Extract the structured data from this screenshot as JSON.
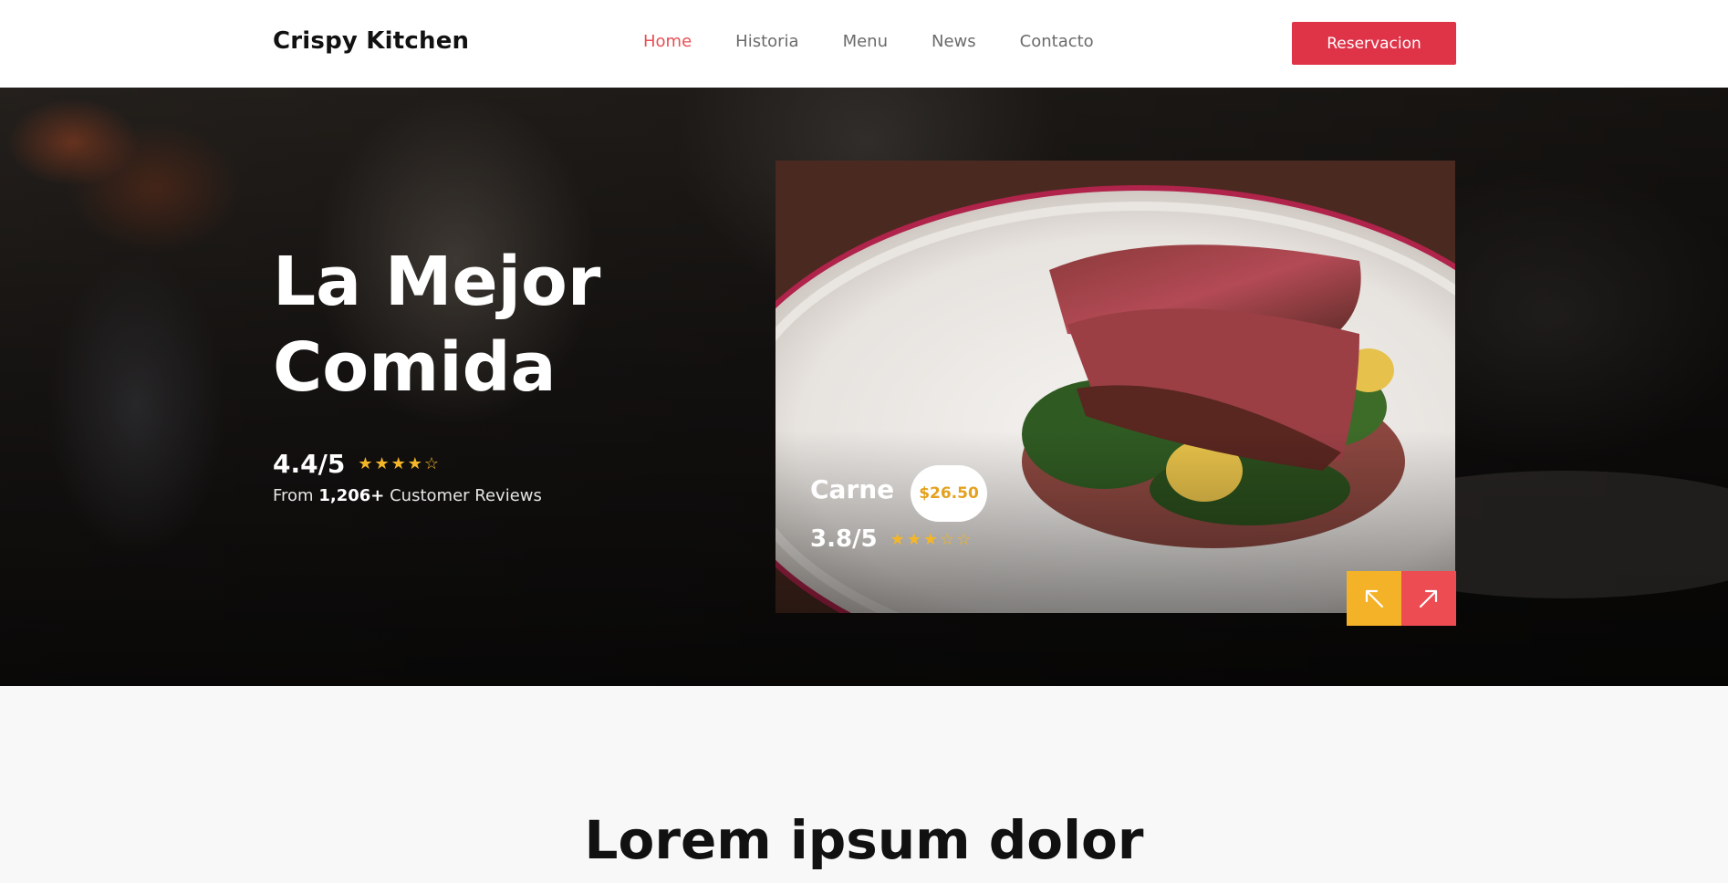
{
  "navbar": {
    "brand": "Crispy Kitchen",
    "links": [
      "Home",
      "Historia",
      "Menu",
      "News",
      "Contacto"
    ],
    "active_link": "Home",
    "reserve_label": "Reservacion"
  },
  "hero": {
    "headline_line1": "La Mejor",
    "headline_line2": "Comida",
    "rating": "4.4/5",
    "rating_stars": 4,
    "reviews_prefix": "From",
    "reviews_count": "1,206+",
    "reviews_suffix": "Customer Reviews"
  },
  "featured_dish": {
    "name": "Carne",
    "price": "$26.50",
    "rating": "3.8/5",
    "rating_stars": 3
  },
  "slider": {
    "prev_icon": "arrow-up-left-icon",
    "next_icon": "arrow-up-right-icon"
  },
  "section": {
    "title": "Lorem ipsum dolor"
  },
  "colors": {
    "accent_red": "#df3348",
    "nav_active": "#e84f55",
    "star_gold": "#f4b629",
    "prev_yellow": "#f4b229",
    "next_red": "#ec4c52"
  }
}
